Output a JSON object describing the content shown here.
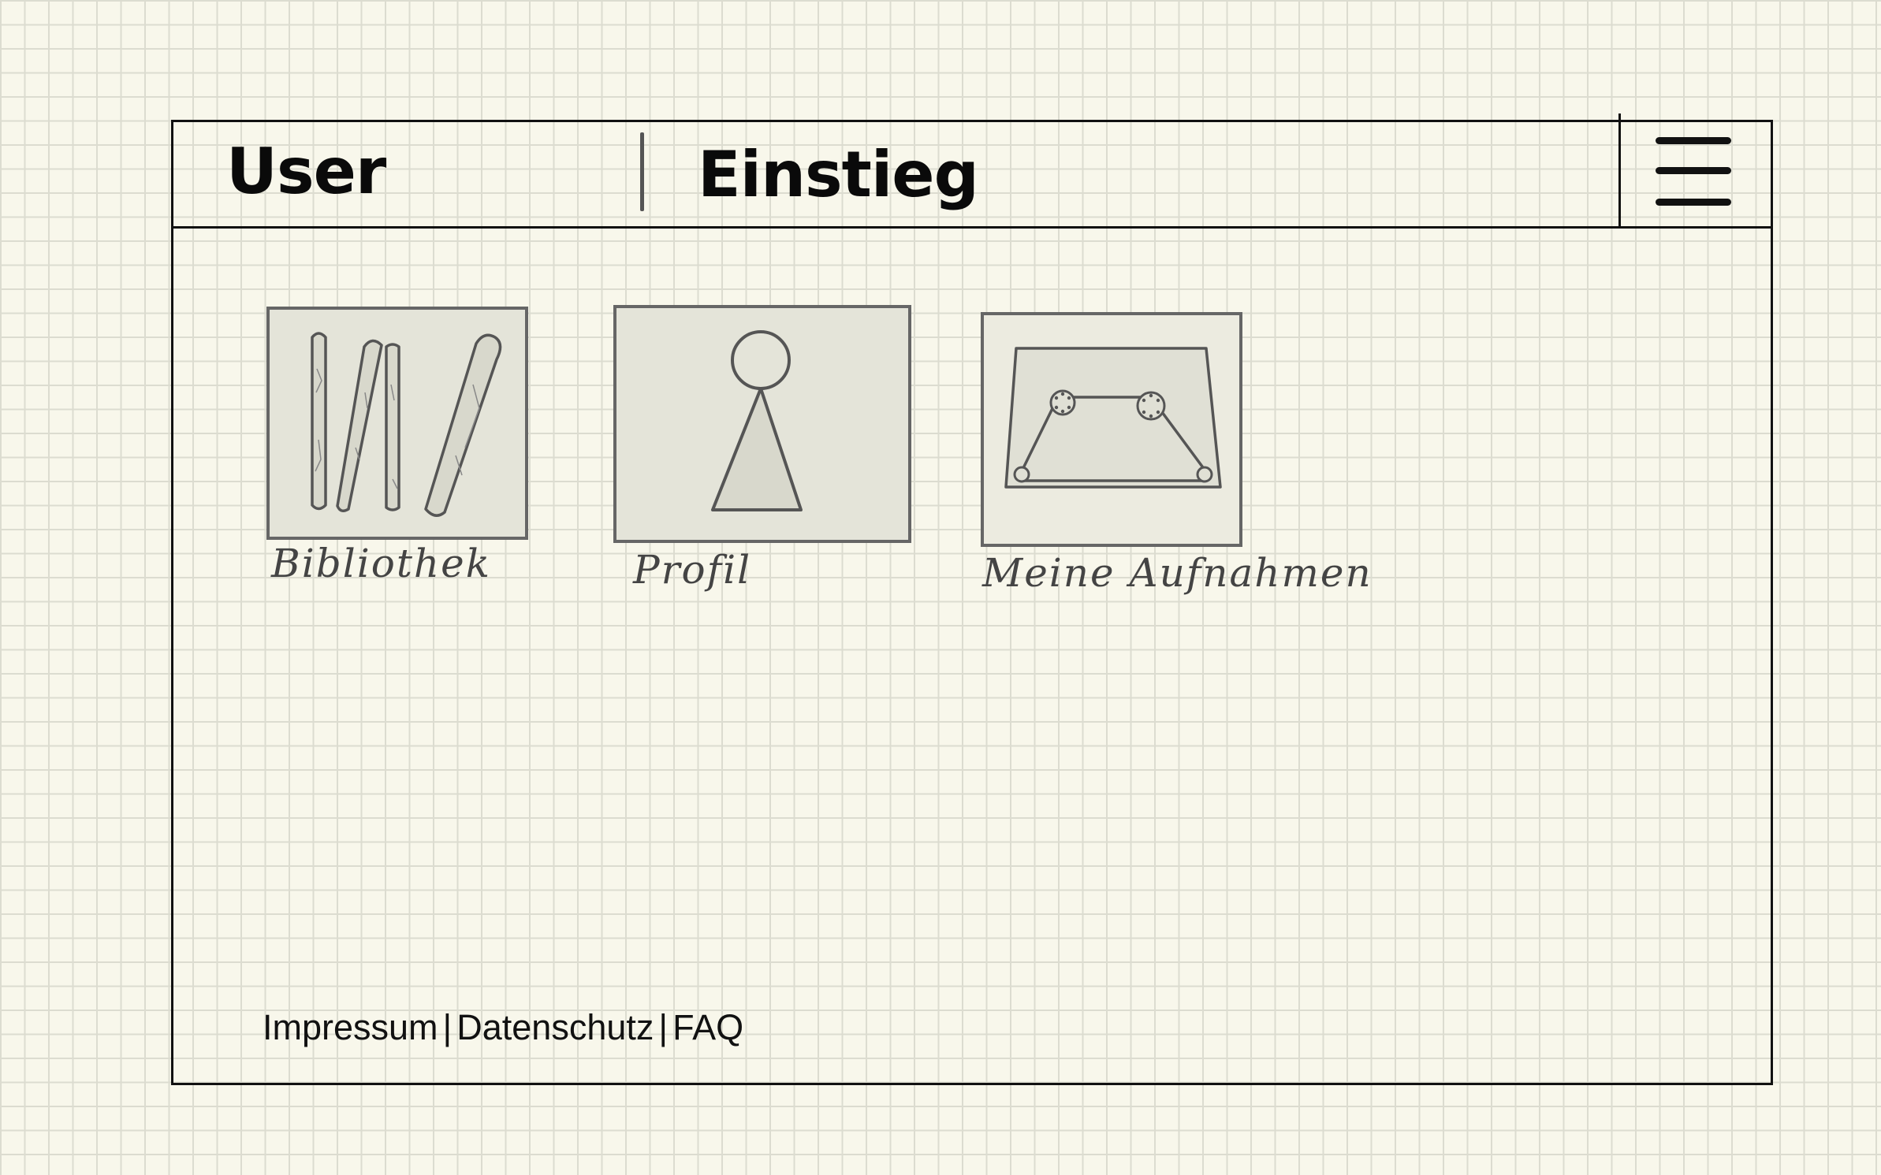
{
  "header": {
    "user_label": "User",
    "page_title": "Einstieg"
  },
  "menu": {
    "icon": "hamburger-menu-icon"
  },
  "tiles": [
    {
      "label": "Bibliothek",
      "icon": "books-icon"
    },
    {
      "label": "Profil",
      "icon": "person-icon"
    },
    {
      "label": "Meine Aufnahmen",
      "icon": "cassette-tape-icon"
    }
  ],
  "footer": {
    "links": [
      "Impressum",
      "Datenschutz",
      "FAQ"
    ],
    "separator": "|"
  },
  "colors": {
    "paper": "#f8f7eb",
    "grid": "#dcdcd0",
    "ink": "#111111",
    "tile_fill": "#e4e4d9",
    "tile_stroke": "#666666"
  }
}
